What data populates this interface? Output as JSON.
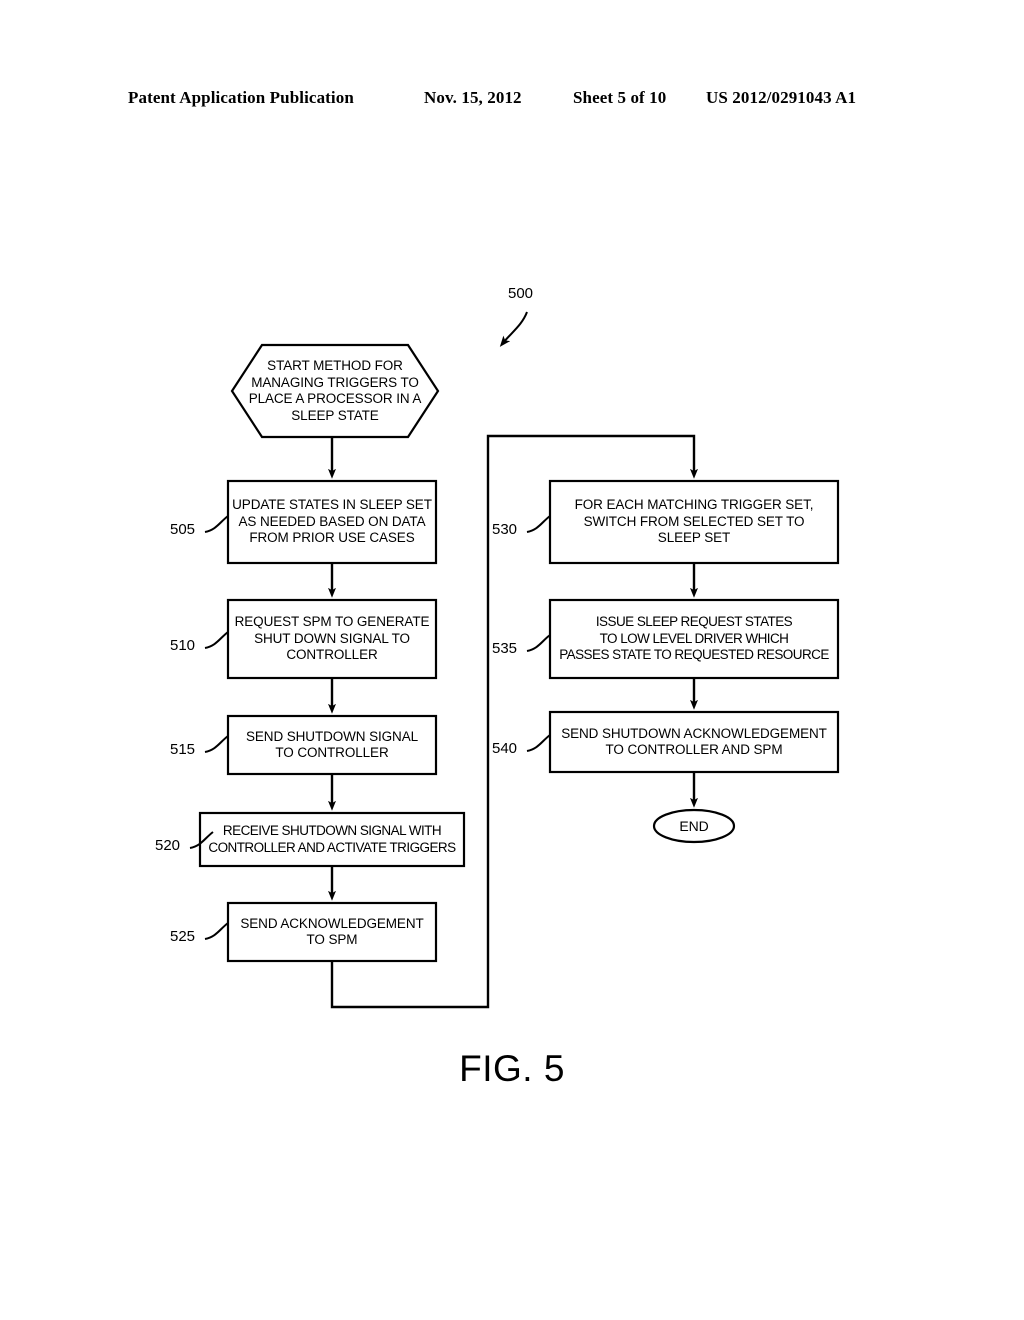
{
  "header": {
    "title": "Patent Application Publication",
    "date": "Nov. 15, 2012",
    "sheet": "Sheet 5 of 10",
    "publication_number": "US 2012/0291043 A1"
  },
  "figure": {
    "caption": "FIG. 5",
    "diagram_reference": "500",
    "type": "flowchart"
  },
  "nodes": {
    "start": {
      "shape": "hexagon",
      "text": "START METHOD FOR\nMANAGING TRIGGERS TO\nPLACE A PROCESSOR IN A\nSLEEP STATE"
    },
    "step_505": {
      "ref": "505",
      "shape": "rectangle",
      "text": "UPDATE STATES IN SLEEP SET\nAS NEEDED BASED ON DATA\nFROM PRIOR USE CASES"
    },
    "step_510": {
      "ref": "510",
      "shape": "rectangle",
      "text": "REQUEST SPM TO GENERATE\nSHUT DOWN SIGNAL TO\nCONTROLLER"
    },
    "step_515": {
      "ref": "515",
      "shape": "rectangle",
      "text": "SEND SHUTDOWN SIGNAL\nTO CONTROLLER"
    },
    "step_520": {
      "ref": "520",
      "shape": "rectangle",
      "text": "RECEIVE SHUTDOWN SIGNAL WITH\nCONTROLLER AND ACTIVATE TRIGGERS"
    },
    "step_525": {
      "ref": "525",
      "shape": "rectangle",
      "text": "SEND ACKNOWLEDGEMENT\nTO SPM"
    },
    "step_530": {
      "ref": "530",
      "shape": "rectangle",
      "text": "FOR EACH MATCHING TRIGGER SET,\nSWITCH FROM SELECTED SET TO\nSLEEP SET"
    },
    "step_535": {
      "ref": "535",
      "shape": "rectangle",
      "text": "ISSUE SLEEP REQUEST STATES\nTO LOW LEVEL DRIVER WHICH\nPASSES STATE TO REQUESTED RESOURCE"
    },
    "step_540": {
      "ref": "540",
      "shape": "rectangle",
      "text": "SEND SHUTDOWN ACKNOWLEDGEMENT\nTO CONTROLLER AND SPM"
    },
    "end": {
      "shape": "ellipse",
      "text": "END"
    }
  },
  "colors": {
    "ink": "#000000",
    "paper": "#ffffff"
  }
}
